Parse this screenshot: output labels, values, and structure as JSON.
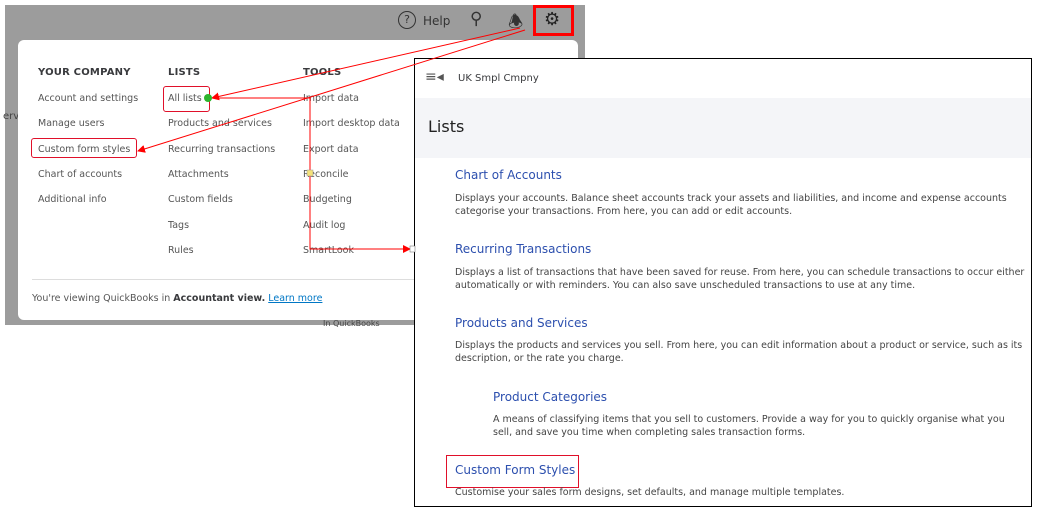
{
  "topbar": {
    "help_label": "Help",
    "icons": [
      "help-icon",
      "search-icon",
      "bell-icon",
      "gear-icon"
    ]
  },
  "background_fragments": {
    "left_text": "ervi",
    "bottom_text": "In QuickBooks"
  },
  "menu": {
    "your_company": {
      "heading": "YOUR COMPANY",
      "items": [
        "Account and settings",
        "Manage users",
        "Custom form styles",
        "Chart of accounts",
        "Additional info"
      ]
    },
    "lists": {
      "heading": "LISTS",
      "items": [
        "All lists",
        "Products and services",
        "Recurring transactions",
        "Attachments",
        "Custom fields",
        "Tags",
        "Rules"
      ]
    },
    "tools": {
      "heading": "TOOLS",
      "items": [
        "Import data",
        "Import desktop data",
        "Export data",
        "Reconcile",
        "Budgeting",
        "Audit log",
        "SmartLook"
      ]
    },
    "footer": {
      "text": "You're viewing QuickBooks in ",
      "bold": "Accountant view.",
      "link": "Learn more"
    }
  },
  "lists_page": {
    "company": "UK Smpl Cmpny",
    "title": "Lists",
    "items": [
      {
        "title": "Chart of Accounts",
        "desc": "Displays your accounts. Balance sheet accounts track your assets and liabilities, and income and expense accounts categorise your transactions. From here, you can add or edit accounts."
      },
      {
        "title": "Recurring Transactions",
        "desc": "Displays a list of transactions that have been saved for reuse. From here, you can schedule transactions to occur either automatically or with reminders. You can also save unscheduled transactions to use at any time."
      },
      {
        "title": "Products and Services",
        "desc": "Displays the products and services you sell. From here, you can edit information about a product or service, such as its description, or the rate you charge."
      },
      {
        "title": "Product Categories",
        "desc": "A means of classifying items that you sell to customers. Provide a way for you to quickly organise what you sell, and save you time when completing sales transaction forms."
      },
      {
        "title": "Custom Form Styles",
        "desc": "Customise your sales form designs, set defaults, and manage multiple templates."
      }
    ]
  },
  "colors": {
    "annotation": "#ff0000",
    "link": "#2c4fae",
    "overlay": "#9c9c9c"
  }
}
